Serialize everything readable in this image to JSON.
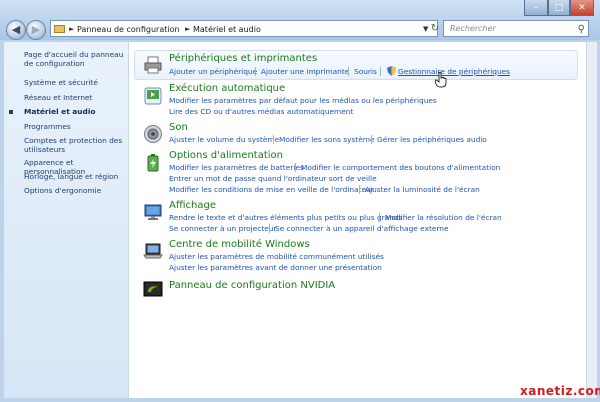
{
  "address": {
    "crumbs": [
      "Panneau de configuration",
      "Matériel et audio"
    ]
  },
  "search": {
    "placeholder": "Rechercher"
  },
  "sidebar": {
    "items": [
      "Page d'accueil du panneau de configuration",
      "Système et sécurité",
      "Réseau et Internet",
      "Matériel et audio",
      "Programmes",
      "Comptes et protection des utilisateurs",
      "Apparence et personnalisation",
      "Horloge, langue et région",
      "Options d'ergonomie"
    ],
    "current_index": 3
  },
  "categories": {
    "printers": {
      "title": "Périphériques et imprimantes",
      "links": [
        "Ajouter un périphérique",
        "Ajouter une imprimante",
        "Souris",
        "Gestionnaire de périphériques"
      ]
    },
    "autoplay": {
      "title": "Exécution automatique",
      "links": [
        "Modifier les paramètres par défaut pour les médias ou les périphériques",
        "Lire des CD ou d'autres médias automatiquement"
      ]
    },
    "sound": {
      "title": "Son",
      "links": [
        "Ajuster le volume du système",
        "Modifier les sons système",
        "Gérer les périphériques audio"
      ]
    },
    "power": {
      "title": "Options d'alimentation",
      "links": [
        "Modifier les paramètres de batteries",
        "Modifier le comportement des boutons d'alimentation",
        "Entrer un mot de passe quand l'ordinateur sort de veille",
        "Modifier les conditions de mise en veille de l'ordinateur",
        "Ajuster la luminosité de l'écran"
      ]
    },
    "display": {
      "title": "Affichage",
      "links": [
        "Rendre le texte et d'autres éléments plus petits ou plus grands",
        "Modifier la résolution de l'écran",
        "Se connecter à un projecteur",
        "Se connecter à un appareil d'affichage externe"
      ]
    },
    "mobility": {
      "title": "Centre de mobilité Windows",
      "links": [
        "Ajuster les paramètres de mobilité communément utilisés",
        "Ajuster les paramètres avant de donner une présentation"
      ]
    },
    "nvidia": {
      "title": "Panneau de configuration NVIDIA"
    }
  },
  "watermark": "xanetiz.com",
  "colors": {
    "title_green": "#1a7a1a",
    "link_blue": "#1f54b5",
    "close_red": "#c7402f"
  }
}
